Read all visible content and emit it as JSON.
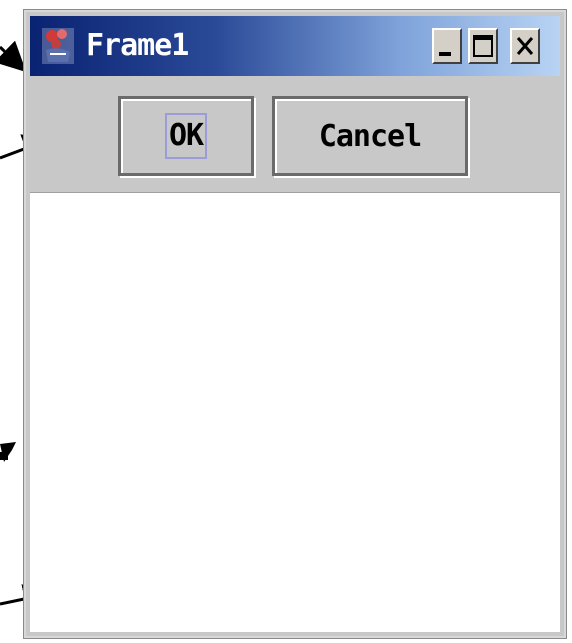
{
  "window": {
    "title": "Frame1",
    "title_gradient": [
      "#0a2272",
      "#b8d3f3"
    ]
  },
  "title_buttons": {
    "minimize_icon": "minimize-icon",
    "maximize_icon": "maximize-icon",
    "close_icon": "close-icon"
  },
  "toolbar": {
    "ok_label": "OK",
    "cancel_label": "Cancel"
  },
  "annotations": {
    "arrow_color": "#000000",
    "arrow_count": 4
  }
}
